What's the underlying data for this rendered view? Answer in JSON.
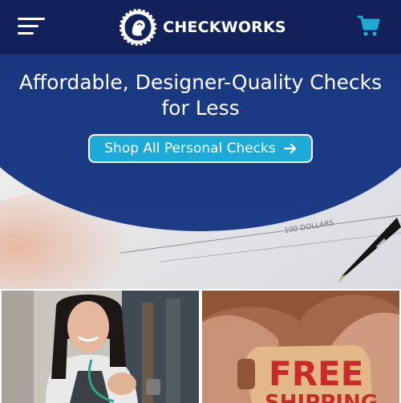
{
  "header": {
    "brand": "CHECKWORKS",
    "icons": {
      "menu": "hamburger-menu-icon",
      "cart": "shopping-cart-icon",
      "logo": "checkworks-logo-icon"
    },
    "colors": {
      "background": "#13215a",
      "cart": "#1eaad6"
    }
  },
  "hero": {
    "title": "Affordable, Designer-Quality Checks for Less",
    "cta_label": "Shop All Personal Checks",
    "cta_icon": "arrow-right-icon",
    "check_text": "100 DOLLARS",
    "colors": {
      "panel": "#1b3983",
      "cta": "#1eaad6"
    }
  },
  "tiles": [
    {
      "image": "smiling-woman-holding-lanyard"
    },
    {
      "image": "hands-holding-free-shipping-tag",
      "tag_text": "FREE",
      "tag_text_partial": "SHIPPING"
    }
  ]
}
